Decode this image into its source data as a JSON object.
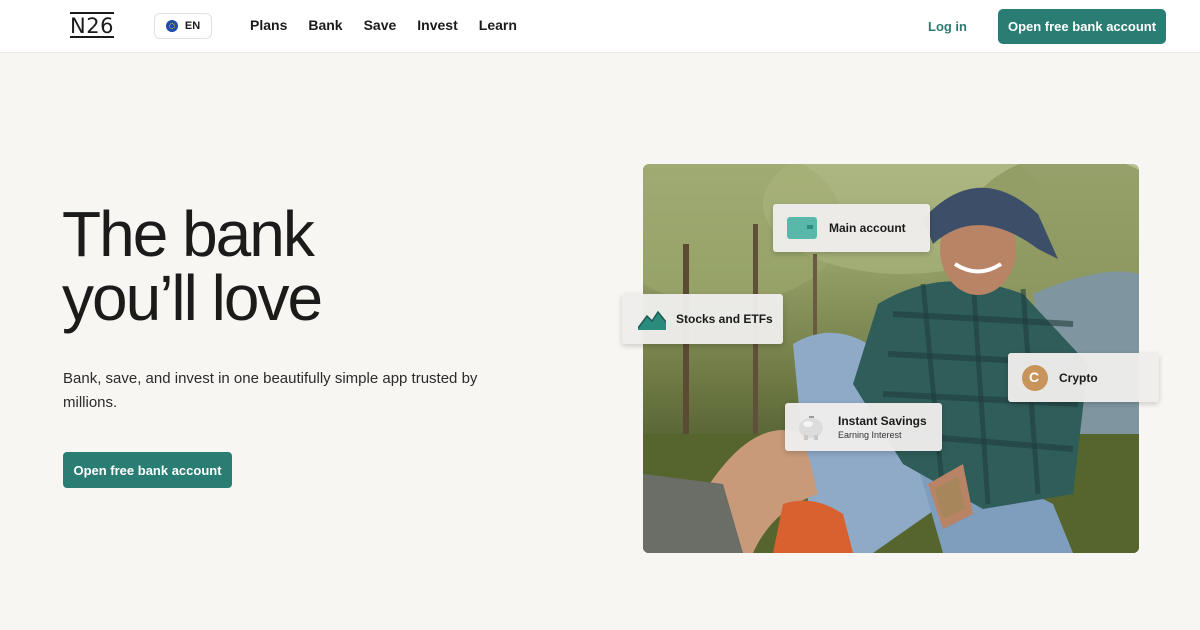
{
  "header": {
    "logo": "N26",
    "language": "EN",
    "nav": [
      "Plans",
      "Bank",
      "Save",
      "Invest",
      "Learn"
    ],
    "login": "Log in",
    "cta": "Open free bank account"
  },
  "hero": {
    "title_line1": "The bank",
    "title_line2": "you’ll love",
    "subtitle": "Bank, save, and invest in one beautifully simple app trusted by millions.",
    "cta": "Open free bank account"
  },
  "cards": {
    "main_account": "Main account",
    "stocks": "Stocks and ETFs",
    "crypto": "Crypto",
    "savings_title": "Instant Savings",
    "savings_sub": "Earning Interest"
  },
  "colors": {
    "accent": "#2a7d73",
    "background": "#f8f6f2"
  },
  "icons": {
    "language": "eu-flag-icon",
    "main_account": "wallet-icon",
    "stocks": "mountain-chart-icon",
    "crypto": "coin-icon",
    "savings": "piggy-bank-icon"
  }
}
